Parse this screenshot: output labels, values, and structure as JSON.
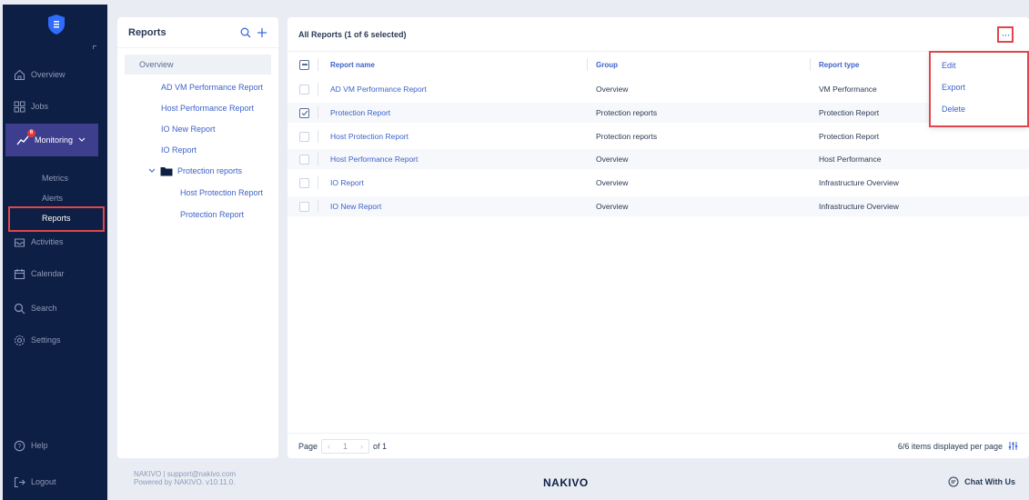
{
  "sidebar": {
    "nav": [
      {
        "label": "Overview",
        "icon": "home-icon"
      },
      {
        "label": "Jobs",
        "icon": "grid-icon"
      },
      {
        "label": "Monitoring",
        "icon": "chart-icon",
        "badge": "6"
      },
      {
        "label": "Activities",
        "icon": "inbox-icon"
      },
      {
        "label": "Calendar",
        "icon": "calendar-icon"
      },
      {
        "label": "Search",
        "icon": "search-icon"
      },
      {
        "label": "Settings",
        "icon": "gear-icon"
      }
    ],
    "monitoring_sub": [
      "Metrics",
      "Alerts",
      "Reports"
    ],
    "help": "Help",
    "logout": "Logout"
  },
  "tree": {
    "title": "Reports",
    "items": [
      {
        "label": "Overview"
      },
      {
        "label": "AD VM Performance Report"
      },
      {
        "label": "Host Performance Report"
      },
      {
        "label": "IO New Report"
      },
      {
        "label": "IO Report"
      },
      {
        "label": "Protection reports"
      },
      {
        "label": "Host Protection Report"
      },
      {
        "label": "Protection Report"
      }
    ]
  },
  "main": {
    "title": "All Reports (1 of 6 selected)",
    "columns": [
      "Report name",
      "Group",
      "Report type"
    ],
    "rows": [
      {
        "name": "AD VM Performance Report",
        "group": "Overview",
        "type": "VM Performance",
        "checked": false
      },
      {
        "name": "Protection Report",
        "group": "Protection reports",
        "type": "Protection Report",
        "checked": true
      },
      {
        "name": "Host Protection Report",
        "group": "Protection reports",
        "type": "Protection Report",
        "checked": false
      },
      {
        "name": "Host Performance Report",
        "group": "Overview",
        "type": "Host Performance",
        "checked": false
      },
      {
        "name": "IO Report",
        "group": "Overview",
        "type": "Infrastructure Overview",
        "checked": false
      },
      {
        "name": "IO New Report",
        "group": "Overview",
        "type": "Infrastructure Overview",
        "checked": false
      }
    ],
    "menu": [
      "Edit",
      "Export",
      "Delete"
    ],
    "more": "···",
    "pager": {
      "page_label": "Page",
      "page": "1",
      "of": "of 1"
    },
    "items_per_page": "6/6 items displayed per page"
  },
  "footer": {
    "copy_line1": "NAKIVO | support@nakivo.com",
    "copy_line2": "Powered by NAKIVO. v10.11.0.",
    "brand": "NAKIVO",
    "chat": "Chat With Us"
  },
  "colors": {
    "sidebar": "#0e1f45",
    "accent": "#3d63c9",
    "highlight": "#e0464b",
    "active_nav": "#3d3f8e"
  }
}
